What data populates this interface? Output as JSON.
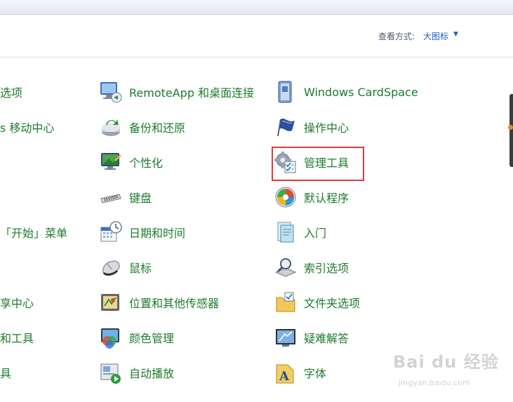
{
  "viewbar": {
    "label": "查看方式:",
    "value": "大图标",
    "caret": "▼"
  },
  "left_items": [
    {
      "label": "选项"
    },
    {
      "label": "s 移动中心"
    },
    {
      "label": "「开始」菜单"
    },
    {
      "label": "享中心"
    },
    {
      "label": "和工具"
    },
    {
      "label": "具"
    }
  ],
  "middle_items": [
    {
      "label": "RemoteApp 和桌面连接",
      "icon": "remoteapp-icon"
    },
    {
      "label": "备份和还原",
      "icon": "backup-icon"
    },
    {
      "label": "个性化",
      "icon": "personalization-icon"
    },
    {
      "label": "键盘",
      "icon": "keyboard-icon"
    },
    {
      "label": "日期和时间",
      "icon": "datetime-icon"
    },
    {
      "label": "鼠标",
      "icon": "mouse-icon"
    },
    {
      "label": "位置和其他传感器",
      "icon": "sensor-icon"
    },
    {
      "label": "颜色管理",
      "icon": "color-management-icon"
    },
    {
      "label": "自动播放",
      "icon": "autoplay-icon"
    }
  ],
  "right_items": [
    {
      "label": "Windows CardSpace",
      "icon": "cardspace-icon"
    },
    {
      "label": "操作中心",
      "icon": "action-center-flag-icon"
    },
    {
      "label": "管理工具",
      "icon": "admin-tools-icon"
    },
    {
      "label": "默认程序",
      "icon": "default-programs-icon"
    },
    {
      "label": "入门",
      "icon": "getting-started-icon"
    },
    {
      "label": "索引选项",
      "icon": "indexing-icon"
    },
    {
      "label": "文件夹选项",
      "icon": "folder-options-icon"
    },
    {
      "label": "疑难解答",
      "icon": "troubleshooting-icon"
    },
    {
      "label": "字体",
      "icon": "fonts-icon"
    }
  ],
  "watermark": {
    "brand": "Bai du 经验",
    "url": "jingyan.baidu.com"
  },
  "colors": {
    "link_green": "#1d7b2c",
    "highlight_red": "#e13b3b",
    "view_blue": "#1e5fb6"
  }
}
